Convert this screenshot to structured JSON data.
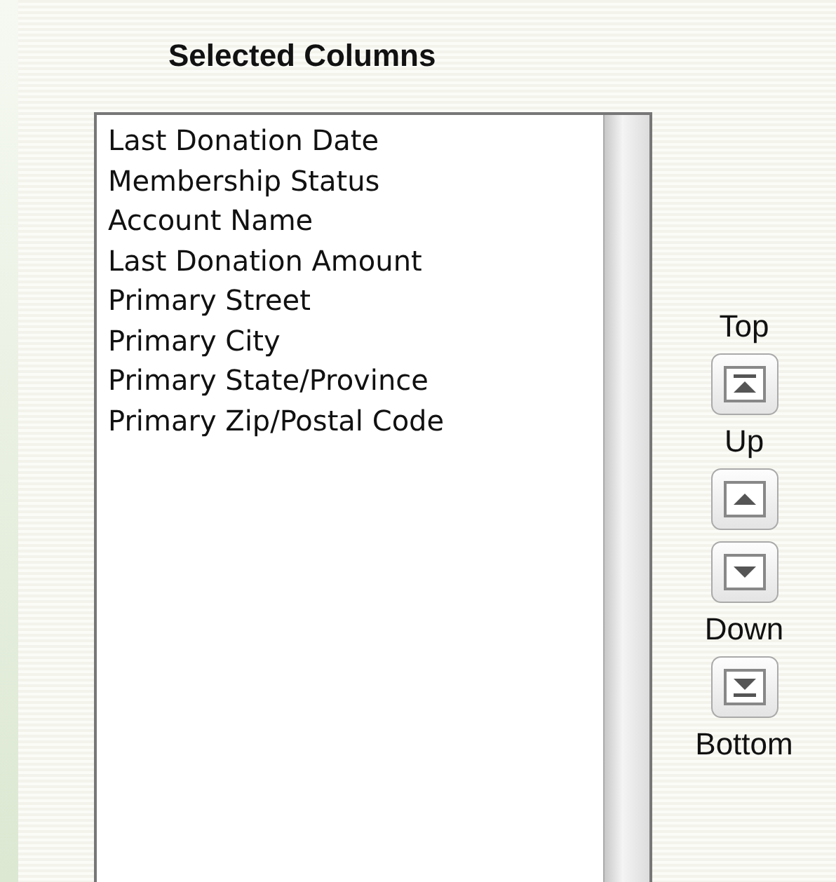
{
  "title": "Selected Columns",
  "columns": [
    "Last Donation Date",
    "Membership Status",
    "Account Name",
    "Last Donation Amount",
    "Primary Street",
    "Primary City",
    "Primary State/Province",
    "Primary Zip/Postal Code"
  ],
  "controls": [
    {
      "kind": "label",
      "text": "Top"
    },
    {
      "kind": "top"
    },
    {
      "kind": "label",
      "text": "Up"
    },
    {
      "kind": "up"
    },
    {
      "kind": "down"
    },
    {
      "kind": "label",
      "text": "Down"
    },
    {
      "kind": "bottom"
    },
    {
      "kind": "label",
      "text": "Bottom"
    }
  ]
}
